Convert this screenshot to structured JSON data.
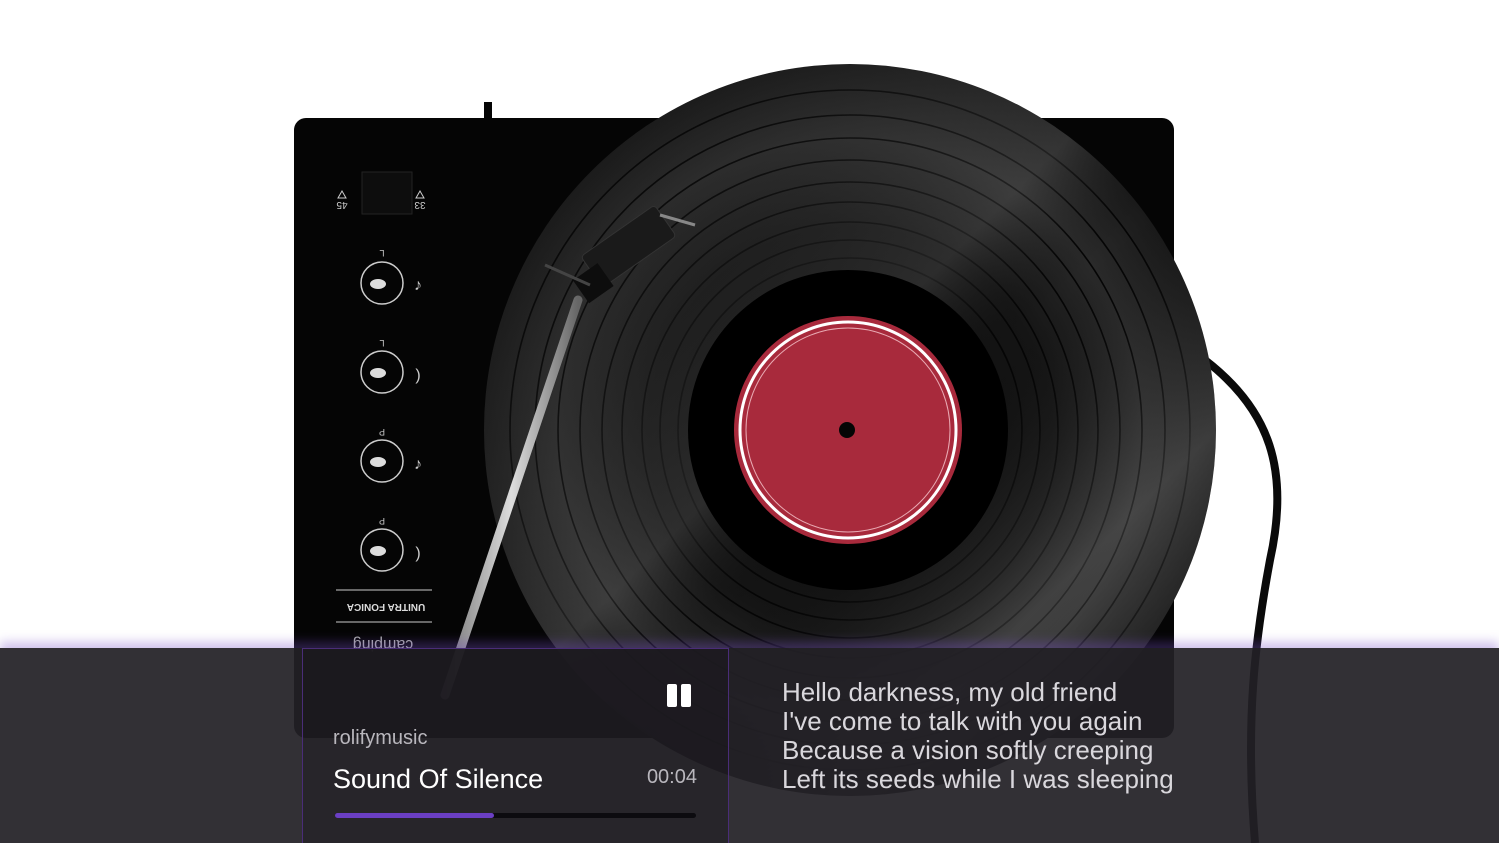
{
  "player": {
    "artist": "rolifymusic",
    "title": "Sound Of Silence",
    "time": "00:04",
    "progress_fraction": 0.44,
    "state": "playing",
    "pause_icon": "pause-icon"
  },
  "lyrics": [
    "Hello darkness, my old friend",
    "I've come to talk with you again",
    "Because a vision softly creeping",
    "Left its seeds while I was sleeping"
  ],
  "turntable": {
    "speed_left": "45",
    "speed_right": "33",
    "knob_labels": [
      "L",
      "L",
      "P",
      "P"
    ],
    "brand_logo": "UNITRA FONICA",
    "model_logo": "camping",
    "label_color": "#a82a3c",
    "accent_color": "#6b3fc4"
  }
}
